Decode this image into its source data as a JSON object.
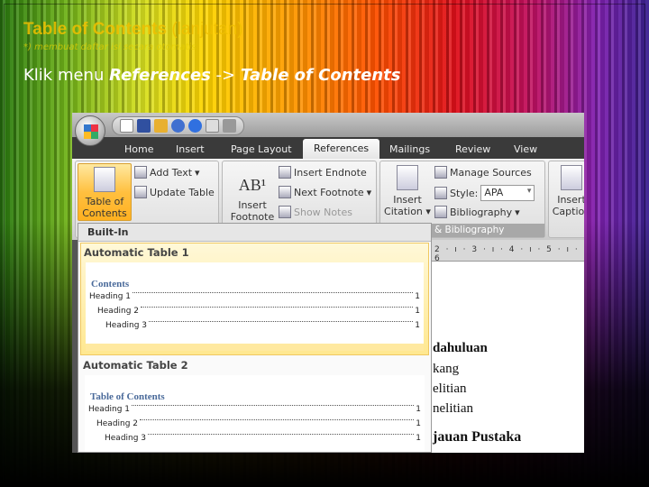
{
  "slide": {
    "title": "Table of Contents",
    "title_suffix": "(lanjutan)",
    "subtitle": "*) membuat daftar isi secara otomatis",
    "instr_prefix": "Klik menu ",
    "instr_menu": "References",
    "instr_arrow": " -> ",
    "instr_target": "Table of Contents"
  },
  "tabs": [
    {
      "label": "Home"
    },
    {
      "label": "Insert"
    },
    {
      "label": "Page Layout"
    },
    {
      "label": "References",
      "active": true
    },
    {
      "label": "Mailings"
    },
    {
      "label": "Review"
    },
    {
      "label": "View"
    }
  ],
  "ribbon": {
    "toc": {
      "big": "Table of Contents",
      "add_text": "Add Text",
      "update_table": "Update Table"
    },
    "footnotes": {
      "insert_footnote": "Insert Footnote",
      "insert_endnote": "Insert Endnote",
      "next_footnote": "Next Footnote",
      "show_notes": "Show Notes"
    },
    "citations": {
      "insert_citation": "Insert Citation",
      "manage_sources": "Manage Sources",
      "style_label": "Style:",
      "style_value": "APA",
      "bibliography": "Bibliography",
      "group_label": "ns & Bibliography"
    },
    "captions": {
      "insert_caption": "Insert Caption"
    }
  },
  "menu": {
    "header": "Built-In",
    "items": [
      {
        "label": "Automatic Table 1",
        "preview_title": "Contents",
        "rows": [
          {
            "text": "Heading 1",
            "page": "1"
          },
          {
            "text": "Heading 2",
            "page": "1"
          },
          {
            "text": "Heading 3",
            "page": "1"
          }
        ]
      },
      {
        "label": "Automatic Table 2",
        "preview_title": "Table of Contents",
        "rows": [
          {
            "text": "Heading 1",
            "page": "1"
          },
          {
            "text": "Heading 2",
            "page": "1"
          },
          {
            "text": "Heading 3",
            "page": "1"
          }
        ]
      }
    ]
  },
  "document": {
    "ruler": "2 · ı · 3 · ı · 4 · ı · 5 · ı · 6",
    "lines": [
      "dahuluan",
      "kang",
      "elitian",
      "nelitian",
      "jauan Pustaka"
    ]
  }
}
